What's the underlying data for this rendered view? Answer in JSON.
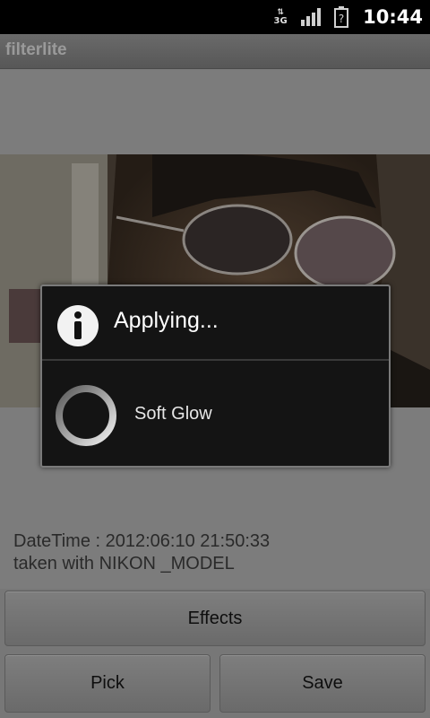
{
  "status_bar": {
    "network_label": "3G",
    "time": "10:44",
    "icons": [
      "data-transfer-icon",
      "signal-strength-icon",
      "battery-unknown-icon"
    ]
  },
  "app": {
    "title": "filterlite"
  },
  "dialog": {
    "title": "Applying...",
    "message": "Soft Glow",
    "icon": "info-icon"
  },
  "exif": {
    "datetime": "DateTime : 2012:06:10 21:50:33",
    "camera": "taken with NIKON _MODEL"
  },
  "buttons": {
    "effects": "Effects",
    "pick": "Pick",
    "save": "Save"
  },
  "colors": {
    "background": "#7c7c7c",
    "dialog_bg": "#141414",
    "dialog_border": "#7a7a7a",
    "status_bar": "#000000"
  }
}
